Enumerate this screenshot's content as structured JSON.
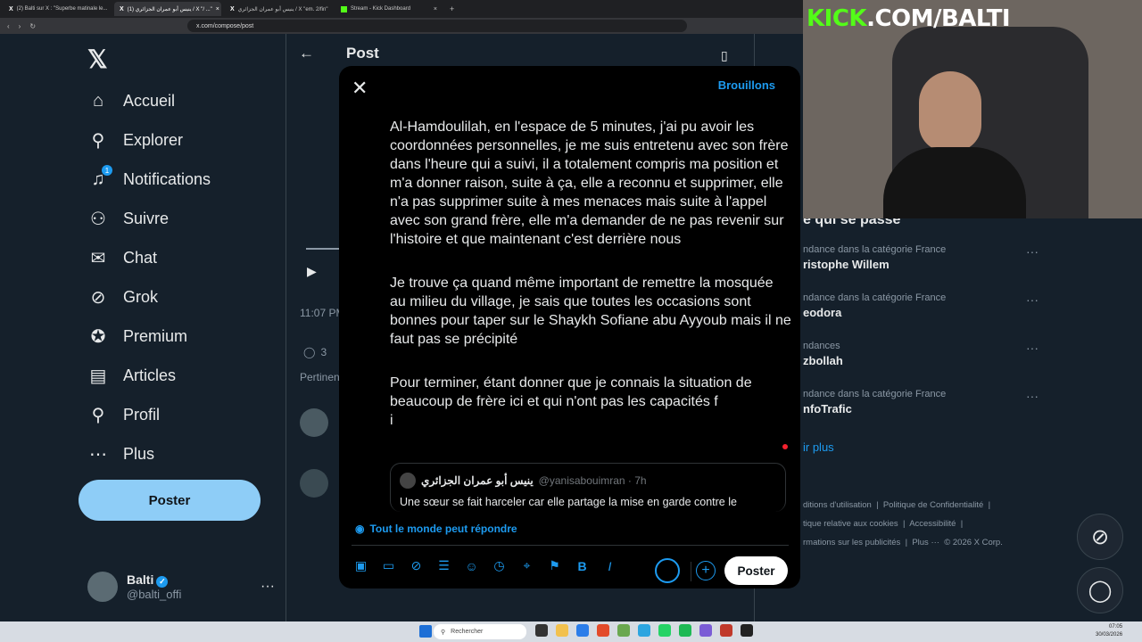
{
  "browser": {
    "tabs": [
      {
        "label": "(2) Balti sur X : \"Superbe matinale le...",
        "icon": "x",
        "active": false
      },
      {
        "label": "(1) ينيس أبو عمران الجزائري / X \"/ ...\"",
        "icon": "x",
        "active": true
      },
      {
        "label": "ينيس أبو عمران الجزائري / X \"em. 2/fin\"",
        "icon": "x",
        "active": false
      },
      {
        "label": "Stream - Kick Dashboard",
        "icon": "kick",
        "active": false
      }
    ],
    "url": "x.com/compose/post"
  },
  "nav": {
    "items": [
      {
        "label": "Accueil",
        "icon": "home-icon",
        "glyph": "⌂"
      },
      {
        "label": "Explorer",
        "icon": "search-icon",
        "glyph": "⚲"
      },
      {
        "label": "Notifications",
        "icon": "bell-icon",
        "glyph": "🔔",
        "badge": "1"
      },
      {
        "label": "Suivre",
        "icon": "add-user-icon",
        "glyph": "👤"
      },
      {
        "label": "Chat",
        "icon": "mail-icon",
        "glyph": "✉"
      },
      {
        "label": "Grok",
        "icon": "grok-icon",
        "glyph": "⊘"
      },
      {
        "label": "Premium",
        "icon": "premium-icon",
        "glyph": "✪"
      },
      {
        "label": "Articles",
        "icon": "articles-icon",
        "glyph": "▤"
      },
      {
        "label": "Profil",
        "icon": "profile-icon",
        "glyph": "👤"
      },
      {
        "label": "Plus",
        "icon": "more-icon",
        "glyph": "⋯"
      }
    ],
    "post_button": "Poster",
    "profile": {
      "name": "Balti",
      "handle": "@balti_offi"
    }
  },
  "post_view": {
    "title": "Post",
    "time": "11:07 PM",
    "replies": "3",
    "filter": "Pertinen"
  },
  "trends": {
    "heading": "e qui se passe",
    "items": [
      {
        "meta": "ndance dans la catégorie France",
        "title": "ristophe Willem"
      },
      {
        "meta": "ndance dans la catégorie France",
        "title": "eodora"
      },
      {
        "meta": "ndances",
        "title": "zbollah"
      },
      {
        "meta": "ndance dans la catégorie France",
        "title": "nfoTrafic"
      }
    ],
    "show_more": "ir plus"
  },
  "footer": [
    "ditions d'utilisation",
    "Politique de Confidentialité",
    "tique relative aux cookies",
    "Accessibilité",
    "rmations sur les publicités",
    "Plus ···",
    "© 2026 X Corp."
  ],
  "compose": {
    "drafts": "Brouillons",
    "paragraphs": [
      "Al-Hamdoulilah, en l'espace de 5 minutes, j'ai pu avoir les coordonnées personnelles, je me suis entretenu avec son frère dans l'heure qui a suivi, il a totalement compris ma position et m'a donner raison, suite à ça, elle a reconnu et supprimer, elle n'a pas supprimer suite à mes menaces mais suite à l'appel avec son grand frère, elle m'a demander de ne pas revenir sur l'histoire et que maintenant c'est derrière nous",
      "Je trouve ça quand même important de remettre la mosquée au milieu du village, je sais que toutes les occasions sont bonnes pour taper sur le Shaykh Sofiane abu Ayyoub mais il ne faut pas se précipité",
      "Pour terminer, étant donner que je connais la situation de beaucoup de frère ici et qui n'ont pas les capacités f\ni"
    ],
    "quote": {
      "name": "ينيس أبو عمران الجزائري",
      "handle": "@yanisabouimran · 7h",
      "text": "Une sœur se fait harceler car elle partage la mise en garde contre le"
    },
    "reply_setting": "Tout le monde peut répondre",
    "post_button": "Poster"
  },
  "overlay": {
    "kick": "KICK",
    "suffix": ".COM/BALTI"
  },
  "taskbar": {
    "search": "Rechercher",
    "time": "07:05",
    "date": "30/03/2026"
  },
  "colors": {
    "accent": "#1d9bf0",
    "background": "#15202b",
    "kick": "#53fc18"
  }
}
